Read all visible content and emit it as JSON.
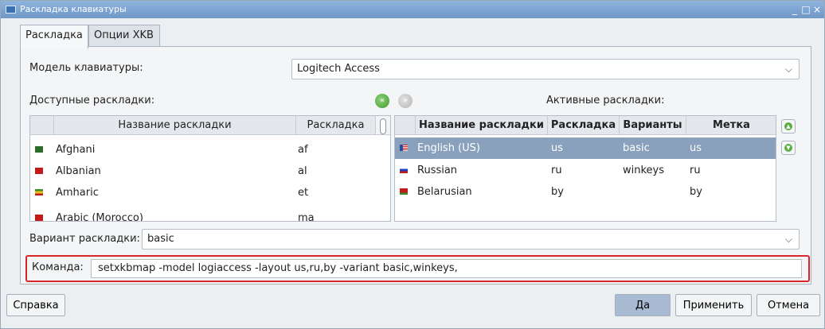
{
  "window": {
    "title": "Раскладка клавиатуры",
    "controls": [
      "_",
      "□",
      "×"
    ]
  },
  "tabs": [
    {
      "label": "Раскладка",
      "active": true
    },
    {
      "label": "Опции XKB",
      "active": false
    }
  ],
  "model": {
    "label": "Модель клавиатуры:",
    "value": "Logitech Access"
  },
  "available": {
    "label": "Доступные раскладки:",
    "columns": [
      "Название раскладки",
      "Раскладка"
    ],
    "rows": [
      {
        "name": "Afghani",
        "code": "af",
        "flag_color": "#2d6b2d"
      },
      {
        "name": "Albanian",
        "code": "al",
        "flag_color": "#c21b1b"
      },
      {
        "name": "Amharic",
        "code": "et",
        "flag_color": "#3b8a2e"
      },
      {
        "name": "Arabic (Morocco)",
        "code": "ma",
        "flag_color": "#c21b1b"
      }
    ],
    "add_icon": "add-layout-icon",
    "remove_icon": "remove-layout-icon"
  },
  "active": {
    "label": "Активные раскладки:",
    "columns": [
      "Название раскладки",
      "Раскладка",
      "Варианты",
      "Метка"
    ],
    "rows": [
      {
        "name": "English (US)",
        "code": "us",
        "variant": "basic",
        "label": "us",
        "selected": true,
        "flag_color": "#2a4d9a"
      },
      {
        "name": "Russian",
        "code": "ru",
        "variant": "winkeys",
        "label": "ru",
        "selected": false,
        "flag_color": "#1e3fbf"
      },
      {
        "name": "Belarusian",
        "code": "by",
        "variant": "",
        "label": "by",
        "selected": false,
        "flag_color": "#c21b1b"
      }
    ],
    "move_up_icon": "move-up-icon",
    "move_down_icon": "move-down-icon"
  },
  "variant": {
    "label": "Вариант раскладки:",
    "value": "basic"
  },
  "command": {
    "label": "Команда:",
    "value": "setxkbmap -model logiaccess -layout us,ru,by -variant basic,winkeys,"
  },
  "buttons": {
    "help": "Справка",
    "ok": "Да",
    "apply": "Применить",
    "cancel": "Отмена"
  },
  "colors": {
    "accent": "#8aa1bd",
    "highlight_frame": "#d8262b"
  }
}
